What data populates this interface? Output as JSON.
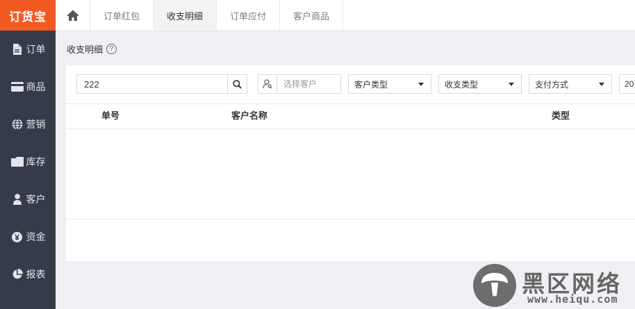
{
  "logo": "订货宝",
  "sidebar": {
    "items": [
      {
        "label": "订单",
        "icon": "document-icon"
      },
      {
        "label": "商品",
        "icon": "card-icon"
      },
      {
        "label": "营销",
        "icon": "globe-icon"
      },
      {
        "label": "库存",
        "icon": "folder-icon"
      },
      {
        "label": "客户",
        "icon": "user-icon"
      },
      {
        "label": "资金",
        "icon": "yen-icon"
      },
      {
        "label": "报表",
        "icon": "pie-chart-icon"
      }
    ]
  },
  "tabs": [
    {
      "label": "订单红包",
      "active": false
    },
    {
      "label": "收支明细",
      "active": true
    },
    {
      "label": "订单应付",
      "active": false
    },
    {
      "label": "客户商品",
      "active": false
    }
  ],
  "breadcrumb": {
    "title": "收支明细",
    "help": "?"
  },
  "filters": {
    "search_value": "222",
    "customer_placeholder": "选择客户",
    "customer_type": "客户类型",
    "income_type": "收支类型",
    "pay_method": "支付方式",
    "date_partial": "20"
  },
  "table": {
    "headers": [
      "单号",
      "客户名称",
      "类型"
    ],
    "rows": []
  },
  "watermark": {
    "title": "黑区网络",
    "url": "www.heiqu.com"
  },
  "colors": {
    "accent": "#f25a22",
    "sidebar": "#353b4a"
  }
}
